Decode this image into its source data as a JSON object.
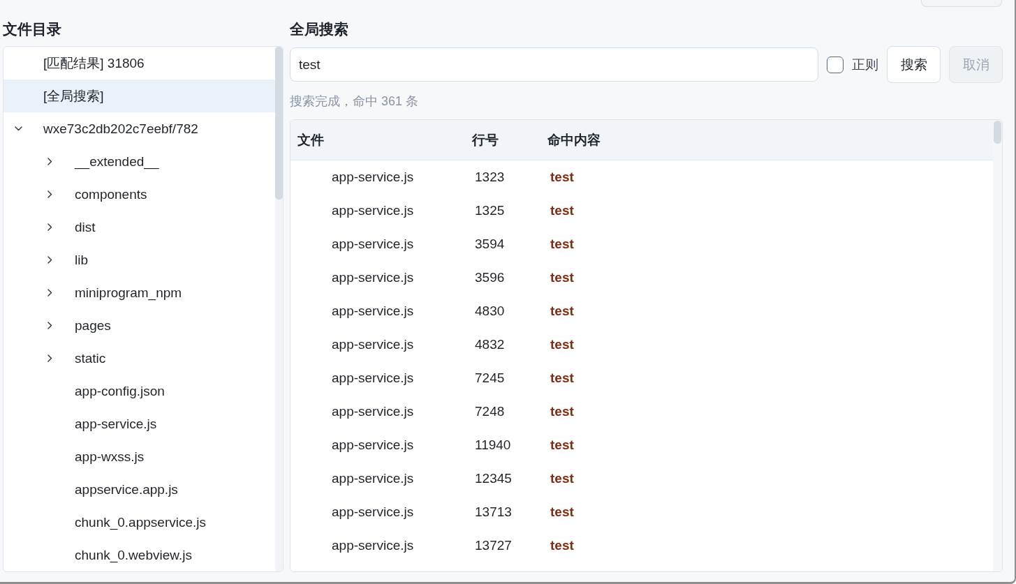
{
  "left_panel": {
    "title": "文件目录",
    "tree": [
      {
        "label": "[匹配结果] 31806",
        "kind": "entry",
        "selected": false
      },
      {
        "label": "[全局搜索]",
        "kind": "entry",
        "selected": true
      },
      {
        "label": "wxe73c2db202c7eebf/782",
        "kind": "folder",
        "expanded": true,
        "selected": false,
        "children": [
          {
            "label": "__extended__",
            "kind": "folder",
            "expanded": false,
            "selected": false
          },
          {
            "label": "components",
            "kind": "folder",
            "expanded": false,
            "selected": false
          },
          {
            "label": "dist",
            "kind": "folder",
            "expanded": false,
            "selected": false
          },
          {
            "label": "lib",
            "kind": "folder",
            "expanded": false,
            "selected": false
          },
          {
            "label": "miniprogram_npm",
            "kind": "folder",
            "expanded": false,
            "selected": false
          },
          {
            "label": "pages",
            "kind": "folder",
            "expanded": false,
            "selected": false
          },
          {
            "label": "static",
            "kind": "folder",
            "expanded": false,
            "selected": false
          },
          {
            "label": "app-config.json",
            "kind": "file",
            "selected": false
          },
          {
            "label": "app-service.js",
            "kind": "file",
            "selected": false
          },
          {
            "label": "app-wxss.js",
            "kind": "file",
            "selected": false
          },
          {
            "label": "appservice.app.js",
            "kind": "file",
            "selected": false
          },
          {
            "label": "chunk_0.appservice.js",
            "kind": "file",
            "selected": false
          },
          {
            "label": "chunk_0.webview.js",
            "kind": "file",
            "selected": false
          }
        ]
      }
    ]
  },
  "search_panel": {
    "title": "全局搜索",
    "query": "test",
    "regex": {
      "label": "正则",
      "checked": false
    },
    "buttons": [
      {
        "label": "搜索",
        "disabled": false
      },
      {
        "label": "取消",
        "disabled": true
      }
    ],
    "status": "搜索完成，命中 361 条",
    "table": {
      "columns": [
        "文件",
        "行号",
        "命中内容"
      ],
      "rows": [
        {
          "file": "app-service.js",
          "line": "1323",
          "match": "test"
        },
        {
          "file": "app-service.js",
          "line": "1325",
          "match": "test"
        },
        {
          "file": "app-service.js",
          "line": "3594",
          "match": "test"
        },
        {
          "file": "app-service.js",
          "line": "3596",
          "match": "test"
        },
        {
          "file": "app-service.js",
          "line": "4830",
          "match": "test"
        },
        {
          "file": "app-service.js",
          "line": "4832",
          "match": "test"
        },
        {
          "file": "app-service.js",
          "line": "7245",
          "match": "test"
        },
        {
          "file": "app-service.js",
          "line": "7248",
          "match": "test"
        },
        {
          "file": "app-service.js",
          "line": "11940",
          "match": "test"
        },
        {
          "file": "app-service.js",
          "line": "12345",
          "match": "test"
        },
        {
          "file": "app-service.js",
          "line": "13713",
          "match": "test"
        },
        {
          "file": "app-service.js",
          "line": "13727",
          "match": "test"
        }
      ]
    }
  }
}
